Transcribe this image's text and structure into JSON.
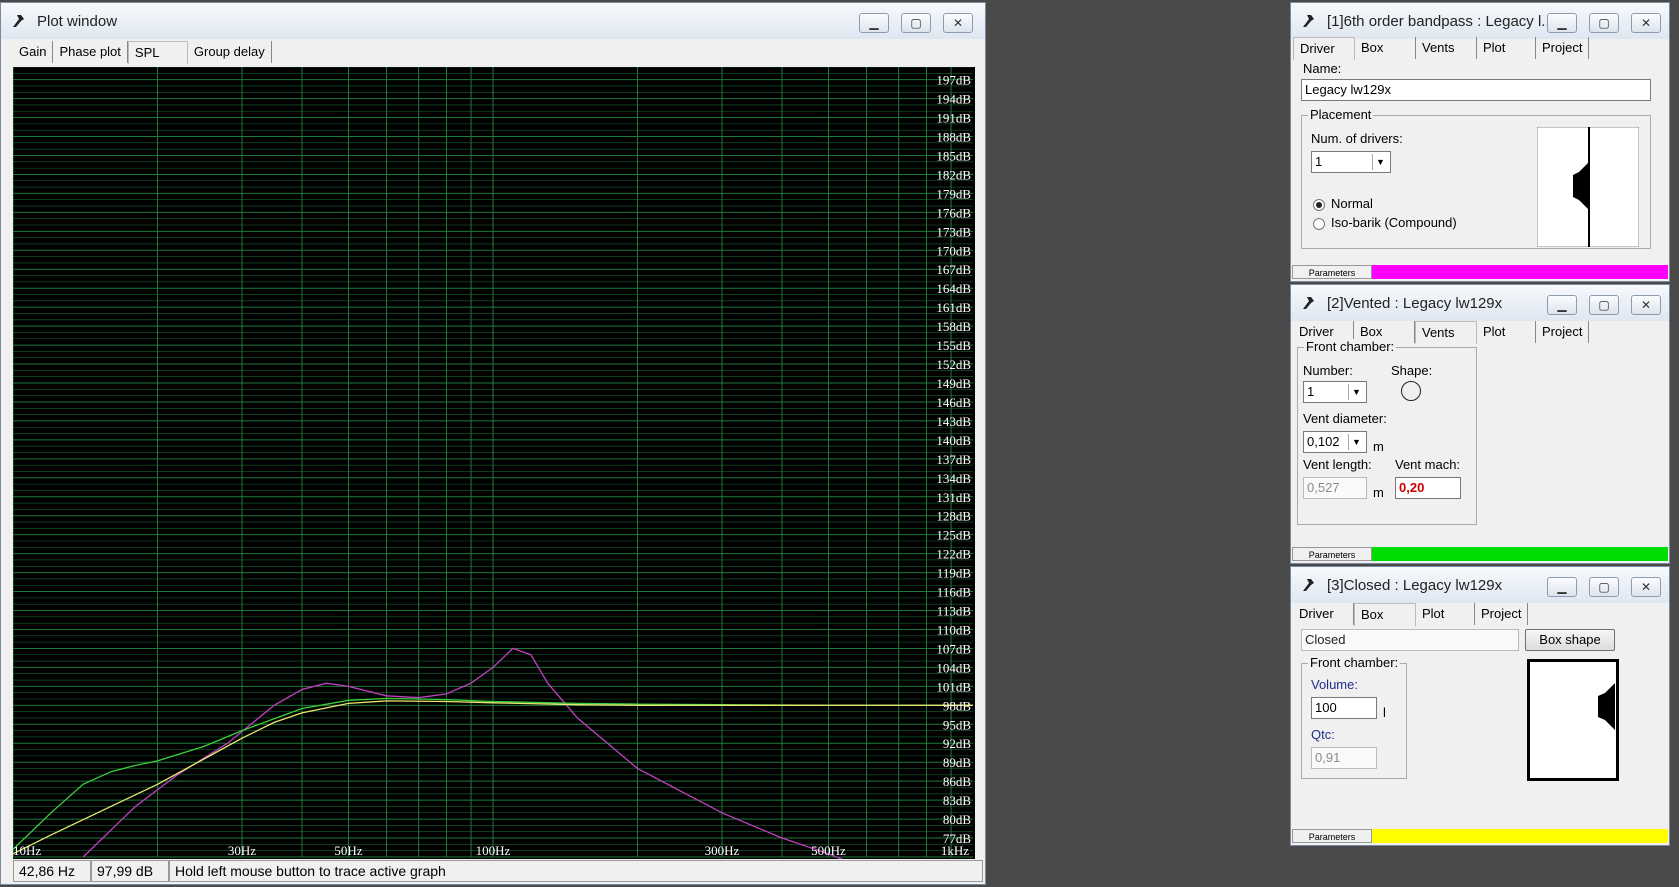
{
  "plot_window": {
    "title": "Plot window",
    "tabs": [
      "Gain",
      "Phase plot",
      "SPL",
      "Group delay"
    ],
    "active_tab": "SPL",
    "status": {
      "frequency": "42,86 Hz",
      "level": "97,99 dB",
      "hint": "Hold left mouse button to trace active graph"
    },
    "buttons": {
      "minimize": "▁",
      "maximize": "▢",
      "close": "✕"
    }
  },
  "chart_data": {
    "type": "line",
    "title": "",
    "xlabel": "",
    "ylabel": "",
    "x_scale": "log",
    "xlim": [
      10,
      1000
    ],
    "ylim": [
      74,
      199
    ],
    "x_ticks": [
      {
        "value": 10,
        "label": "10Hz"
      },
      {
        "value": 30,
        "label": "30Hz"
      },
      {
        "value": 50,
        "label": "50Hz"
      },
      {
        "value": 100,
        "label": "100Hz"
      },
      {
        "value": 300,
        "label": "300Hz"
      },
      {
        "value": 500,
        "label": "500Hz"
      },
      {
        "value": 1000,
        "label": "1kHz"
      }
    ],
    "y_ticks": [
      {
        "value": 197,
        "label": "197dB"
      },
      {
        "value": 194,
        "label": "194dB"
      },
      {
        "value": 191,
        "label": "191dB"
      },
      {
        "value": 188,
        "label": "188dB"
      },
      {
        "value": 185,
        "label": "185dB"
      },
      {
        "value": 182,
        "label": "182dB"
      },
      {
        "value": 179,
        "label": "179dB"
      },
      {
        "value": 176,
        "label": "176dB"
      },
      {
        "value": 173,
        "label": "173dB"
      },
      {
        "value": 170,
        "label": "170dB"
      },
      {
        "value": 167,
        "label": "167dB"
      },
      {
        "value": 164,
        "label": "164dB"
      },
      {
        "value": 161,
        "label": "161dB"
      },
      {
        "value": 158,
        "label": "158dB"
      },
      {
        "value": 155,
        "label": "155dB"
      },
      {
        "value": 152,
        "label": "152dB"
      },
      {
        "value": 149,
        "label": "149dB"
      },
      {
        "value": 146,
        "label": "146dB"
      },
      {
        "value": 143,
        "label": "143dB"
      },
      {
        "value": 140,
        "label": "140dB"
      },
      {
        "value": 137,
        "label": "137dB"
      },
      {
        "value": 134,
        "label": "134dB"
      },
      {
        "value": 131,
        "label": "131dB"
      },
      {
        "value": 128,
        "label": "128dB"
      },
      {
        "value": 125,
        "label": "125dB"
      },
      {
        "value": 122,
        "label": "122dB"
      },
      {
        "value": 119,
        "label": "119dB"
      },
      {
        "value": 116,
        "label": "116dB"
      },
      {
        "value": 113,
        "label": "113dB"
      },
      {
        "value": 110,
        "label": "110dB"
      },
      {
        "value": 107,
        "label": "107dB"
      },
      {
        "value": 104,
        "label": "104dB"
      },
      {
        "value": 101,
        "label": "101dB"
      },
      {
        "value": 98,
        "label": "98dB"
      },
      {
        "value": 95,
        "label": "95dB"
      },
      {
        "value": 92,
        "label": "92dB"
      },
      {
        "value": 89,
        "label": "89dB"
      },
      {
        "value": 86,
        "label": "86dB"
      },
      {
        "value": 83,
        "label": "83dB"
      },
      {
        "value": 80,
        "label": "80dB"
      },
      {
        "value": 77,
        "label": "77dB"
      }
    ],
    "grid": true,
    "background": "#000000",
    "grid_color": "#1f7a3a",
    "series": [
      {
        "color": "#c040c0",
        "x": [
          14,
          18,
          22,
          28,
          35,
          40,
          45,
          50,
          60,
          70,
          80,
          90,
          100,
          110,
          120,
          130,
          150,
          200,
          300,
          400,
          500,
          560
        ],
        "y": [
          74,
          82,
          87,
          92,
          98,
          100.5,
          101.5,
          101,
          99.5,
          99.2,
          99.8,
          101.5,
          104,
          107,
          106,
          101.5,
          96,
          88,
          81,
          77,
          74.5,
          73
        ]
      },
      {
        "color": "#3ccf3c",
        "x": [
          10,
          12,
          14,
          16,
          18,
          20,
          25,
          30,
          40,
          50,
          60,
          80,
          100,
          150,
          200,
          300,
          500,
          1000
        ],
        "y": [
          75.2,
          81,
          85.5,
          87.5,
          88.5,
          89.2,
          91.5,
          94,
          97.5,
          98.8,
          99.1,
          98.9,
          98.6,
          98.3,
          98.2,
          98.1,
          98.0,
          98.0
        ]
      },
      {
        "color": "#e8e870",
        "x": [
          10,
          12,
          15,
          20,
          25,
          30,
          35,
          40,
          50,
          60,
          80,
          100,
          150,
          200,
          300,
          500,
          1000
        ],
        "y": [
          74.5,
          77.5,
          81,
          85.5,
          89.5,
          92.8,
          95.3,
          96.8,
          98.3,
          98.7,
          98.6,
          98.4,
          98.1,
          98.0,
          98.0,
          98.0,
          98.0
        ]
      }
    ]
  },
  "win1": {
    "title": "[1]6th order bandpass : Legacy l...",
    "tabs": [
      "Driver",
      "Box",
      "Vents",
      "Plot",
      "Project"
    ],
    "active_tab": "Driver",
    "name_label": "Name:",
    "name_value": "Legacy lw129x",
    "placement_label": "Placement",
    "num_drivers_label": "Num. of drivers:",
    "num_drivers_value": "1",
    "radio_normal": "Normal",
    "radio_iso": "Iso-barik (Compound)",
    "params_label": "Parameters",
    "params_color": "#ff00ff"
  },
  "win2": {
    "title": "[2]Vented : Legacy lw129x",
    "tabs": [
      "Driver",
      "Box",
      "Vents",
      "Plot",
      "Project"
    ],
    "active_tab": "Vents",
    "front_chamber": "Front chamber:",
    "number_label": "Number:",
    "number_value": "1",
    "shape_label": "Shape:",
    "vent_diameter_label": "Vent diameter:",
    "vent_diameter_value": "0,102",
    "unit_m": "m",
    "vent_length_label": "Vent length:",
    "vent_length_value": "0,527",
    "vent_mach_label": "Vent mach:",
    "vent_mach_value": "0,20",
    "params_label": "Parameters",
    "params_color": "#00dd00"
  },
  "win3": {
    "title": "[3]Closed : Legacy lw129x",
    "tabs": [
      "Driver",
      "Box",
      "Plot",
      "Project"
    ],
    "active_tab": "Box",
    "box_type": "Closed",
    "box_shape_button": "Box shape",
    "front_chamber": "Front chamber:",
    "volume_label": "Volume:",
    "volume_value": "100",
    "volume_unit": "l",
    "qtc_label": "Qtc:",
    "qtc_value": "0,91",
    "params_label": "Parameters",
    "params_color": "#ffff00"
  }
}
